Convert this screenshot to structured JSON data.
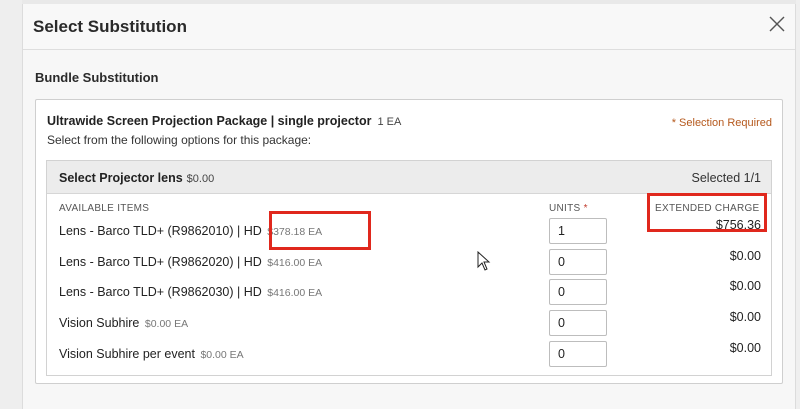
{
  "modal": {
    "title": "Select Substitution",
    "section_title": "Bundle Substitution"
  },
  "package": {
    "name": "Ultrawide Screen Projection Package | single projector",
    "quantity": "1 EA",
    "instruction": "Select from the following options for this package:",
    "selection_required": "* Selection Required"
  },
  "group": {
    "title": "Select Projector lens",
    "price": "$0.00",
    "selected": "Selected 1/1",
    "columns": {
      "available": "AVAILABLE ITEMS",
      "units": "UNITS",
      "units_required_marker": "*",
      "extended": "EXTENDED CHARGE"
    },
    "items": [
      {
        "name": "Lens - Barco TLD+ (R9862010) | HD",
        "price": "$378.18 EA",
        "units": "1",
        "charge": "$756.36"
      },
      {
        "name": "Lens - Barco TLD+ (R9862020) | HD",
        "price": "$416.00 EA",
        "units": "0",
        "charge": "$0.00"
      },
      {
        "name": "Lens - Barco TLD+ (R9862030) | HD",
        "price": "$416.00 EA",
        "units": "0",
        "charge": "$0.00"
      },
      {
        "name": "Vision Subhire",
        "price": "$0.00 EA",
        "units": "0",
        "charge": "$0.00"
      },
      {
        "name": "Vision Subhire per event",
        "price": "$0.00 EA",
        "units": "0",
        "charge": "$0.00"
      }
    ]
  },
  "colors": {
    "highlight": "#e0281d",
    "selection_required": "#b5581c",
    "header_bg": "#ececec"
  },
  "icons": {
    "close": "close-icon",
    "cursor": "mouse-pointer-icon"
  }
}
